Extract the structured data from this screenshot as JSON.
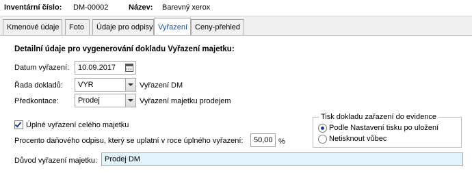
{
  "header": {
    "inventory_label": "Inventární číslo:",
    "inventory_value": "DM-00002",
    "name_label": "Název:",
    "name_value": "Barevný xerox"
  },
  "tabs": [
    {
      "label": "Kmenové údaje",
      "active": false
    },
    {
      "label": "Foto",
      "active": false
    },
    {
      "label": "Údaje pro odpisy",
      "active": false
    },
    {
      "label": "Vyřazení",
      "active": true
    },
    {
      "label": "Ceny-přehled",
      "active": false
    }
  ],
  "form": {
    "section_title": "Detailní údaje pro vygenerování dokladu Vyřazení majetku:",
    "date_label": "Datum vyřazení:",
    "date_value": "10.09.2017",
    "series_label": "Řada dokladů:",
    "series_value": "VYR",
    "series_description": "Vyřazení DM",
    "precontation_label": "Předkontace:",
    "precontation_value": "Prodej",
    "precontation_description": "Vyřazení majetku prodejem",
    "full_disposal_label": "Úplné vyřazení celého majetku",
    "full_disposal_checked": true,
    "percent_label": "Procento daňového odpisu, který se uplatní v roce úplného vyřazení:",
    "percent_value": "50,00",
    "percent_unit": "%",
    "reason_label": "Důvod vyřazení majetku:",
    "reason_value": "Prodej DM",
    "reason_field_color": "#e3f3fb"
  },
  "print_group": {
    "title": "Tisk dokladu zařazení do evidence",
    "options": [
      {
        "label": "Podle Nastavení tisku po uložení",
        "selected": true
      },
      {
        "label": "Netisknout vůbec",
        "selected": false
      }
    ]
  }
}
